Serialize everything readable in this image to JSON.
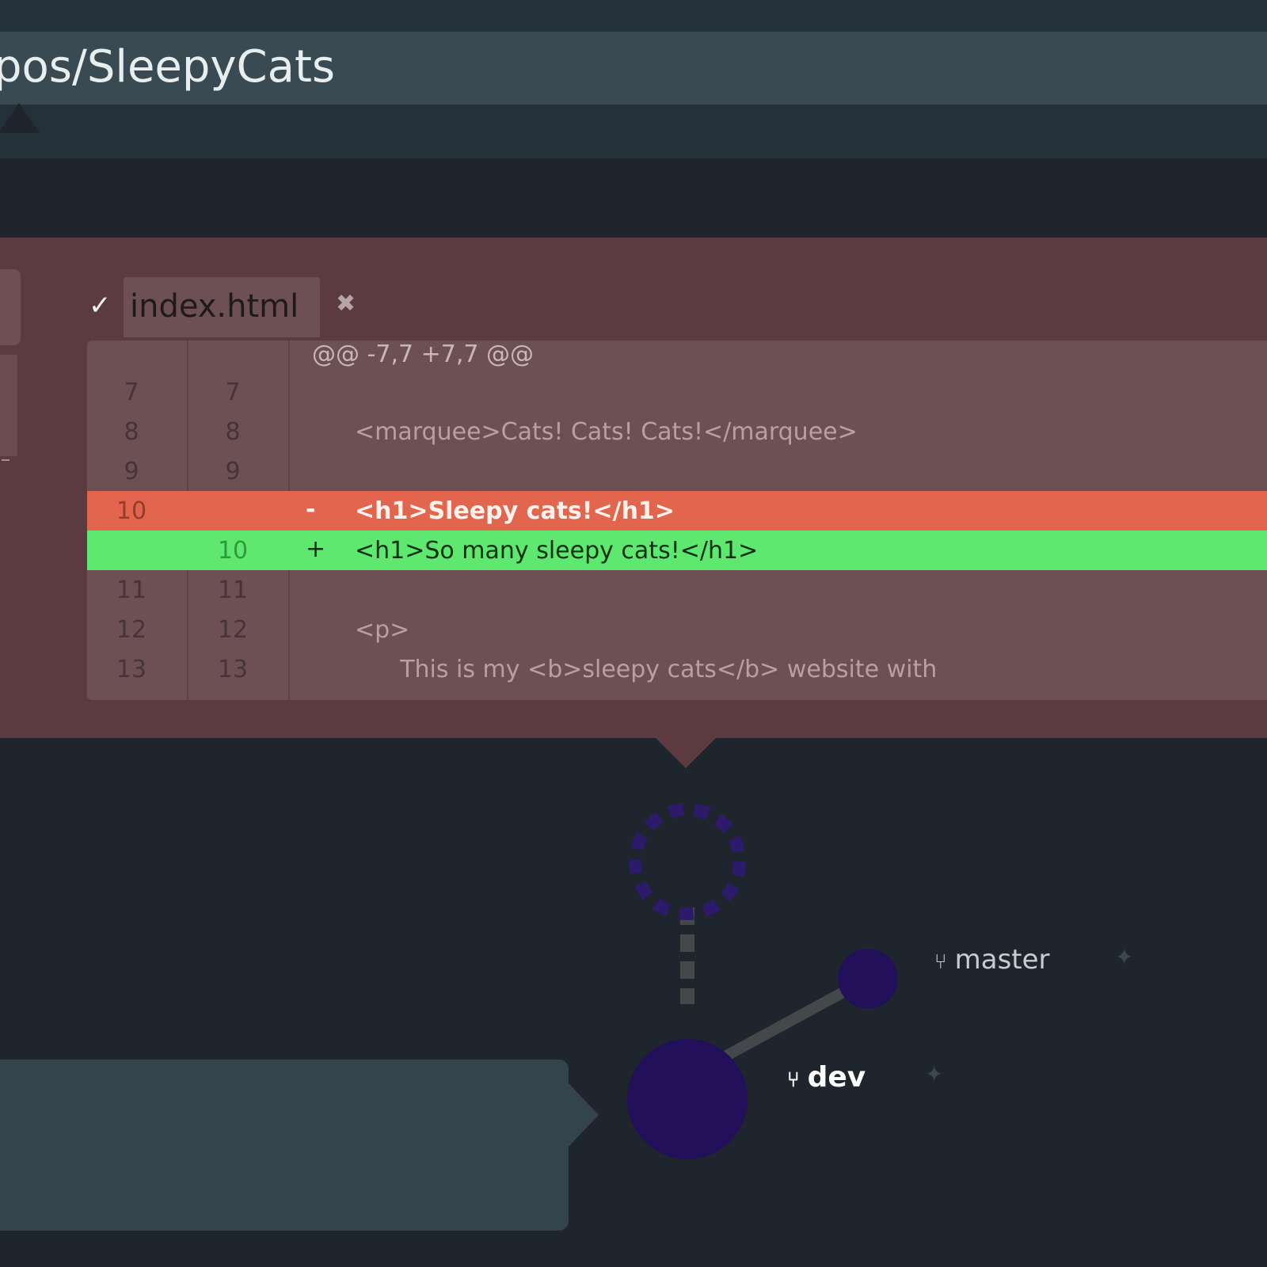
{
  "header": {
    "path": "pos/SleepyCats"
  },
  "diff": {
    "file_name": "index.html",
    "check_icon": "✓",
    "close_icon": "✖",
    "hunk_header": "@@ -7,7 +7,7 @@",
    "lines": [
      {
        "old": "7",
        "new": "7",
        "sign": "",
        "code": "",
        "type": "ctx"
      },
      {
        "old": "8",
        "new": "8",
        "sign": "",
        "code": "<marquee>Cats! Cats! Cats!</marquee>",
        "type": "ctx"
      },
      {
        "old": "9",
        "new": "9",
        "sign": "",
        "code": "",
        "type": "ctx"
      },
      {
        "old": "10",
        "new": "",
        "sign": "-",
        "code": "<h1>Sleepy cats!</h1>",
        "type": "del"
      },
      {
        "old": "",
        "new": "10",
        "sign": "+",
        "code": "<h1>So many sleepy cats!</h1>",
        "type": "add"
      },
      {
        "old": "11",
        "new": "11",
        "sign": "",
        "code": "",
        "type": "ctx"
      },
      {
        "old": "12",
        "new": "12",
        "sign": "",
        "code": "<p>",
        "type": "ctx"
      },
      {
        "old": "13",
        "new": "13",
        "sign": "",
        "code": "      This is my <b>sleepy cats</b> website with",
        "type": "ctx"
      }
    ]
  },
  "graph": {
    "branches": [
      {
        "name": "master",
        "icon": "branch-icon"
      },
      {
        "name": "dev",
        "icon": "branch-icon"
      }
    ],
    "colors": {
      "node": "#22105a",
      "pending_node": "#2e1a6a",
      "edge": "#45484a"
    }
  }
}
